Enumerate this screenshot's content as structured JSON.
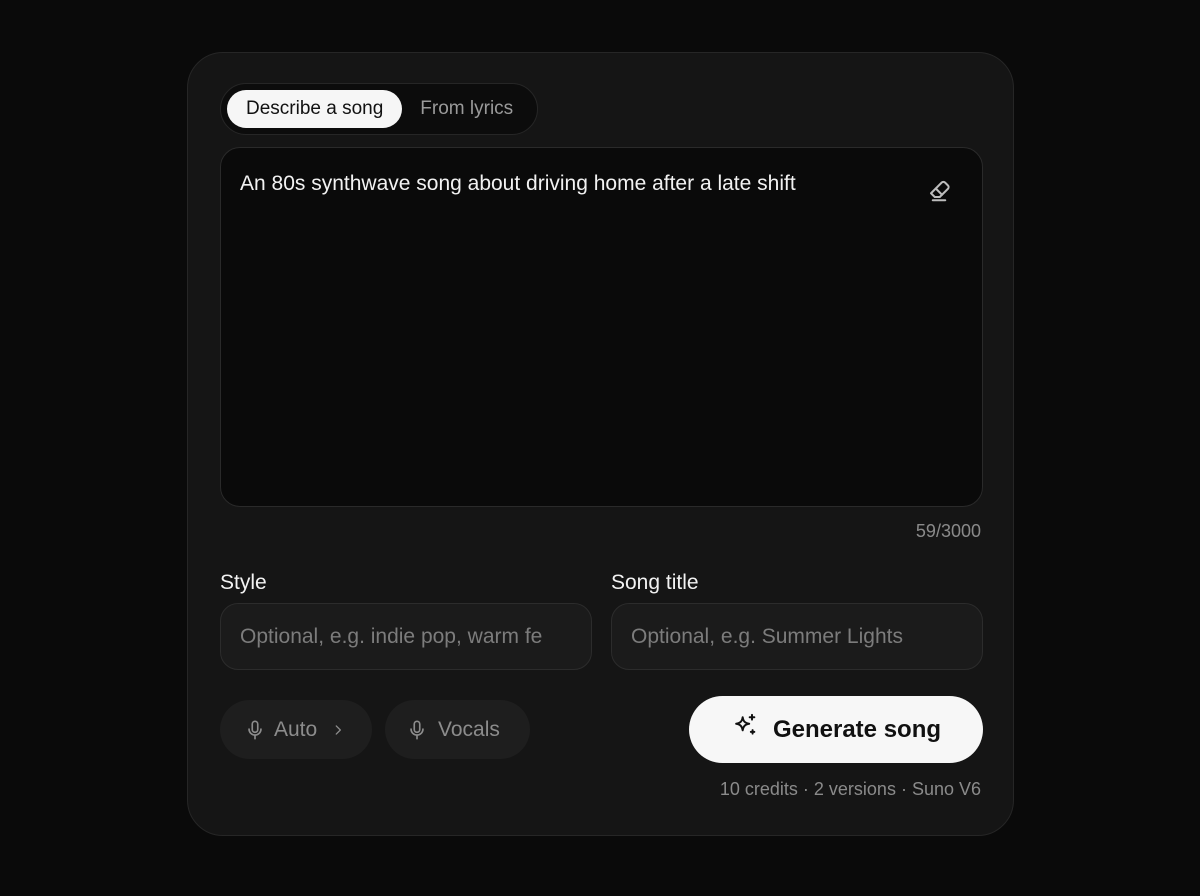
{
  "tabs": {
    "describe": "Describe a song",
    "lyrics": "From lyrics"
  },
  "prompt": {
    "text": "An 80s synthwave song about driving home after a late shift",
    "counter": "59/3000"
  },
  "style": {
    "label": "Style",
    "placeholder": "Optional, e.g. indie pop, warm fe"
  },
  "title": {
    "label": "Song title",
    "placeholder": "Optional, e.g. Summer Lights"
  },
  "options": {
    "auto": "Auto",
    "vocals": "Vocals"
  },
  "generate": {
    "label": "Generate song"
  },
  "meta": "10 credits · 2 versions · Suno V6",
  "icons": {
    "eraser": "eraser-icon",
    "mic": "microphone-icon",
    "chevron": "chevron-right-icon",
    "sparkle": "sparkles-icon"
  },
  "colors": {
    "background": "#0a0a0a",
    "card": "#151515",
    "primary_button": "#f7f7f7"
  }
}
